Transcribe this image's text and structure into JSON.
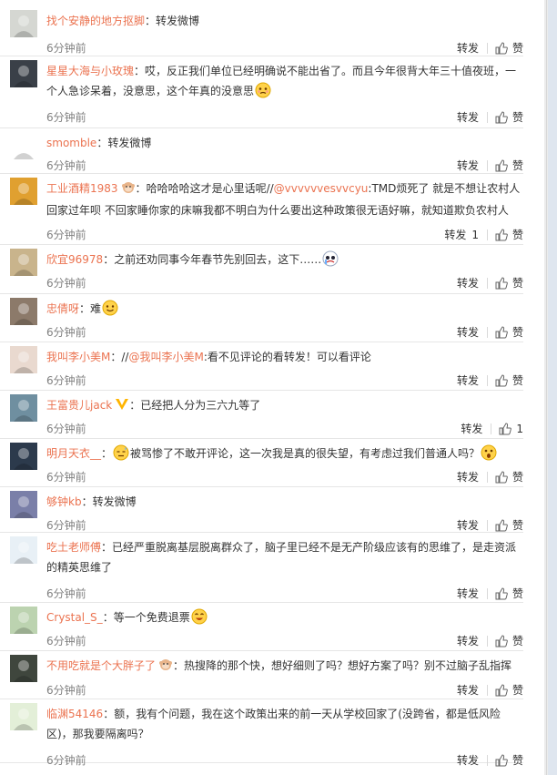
{
  "labels": {
    "repost": "转发",
    "like": "赞"
  },
  "comments": [
    {
      "user": "找个安静的地方抠脚",
      "pre": "：",
      "text": "转发微博",
      "time": "6分钟前",
      "avatar_color": "#d5d7d2"
    },
    {
      "user": "星星大海与小玫瑰",
      "pre": "：",
      "text": "哎，反正我们单位已经明确说不能出省了。而且今年很背大年三十值夜班，一个人急诊呆着，没意思，这个年真的没意思",
      "emoji": "awkward-face",
      "time": "6分钟前",
      "avatar_color": "#3a4048"
    },
    {
      "user": "smomble",
      "pre": "：",
      "text": "转发微博",
      "time": "6分钟前",
      "avatar_color": "#ffffff"
    },
    {
      "user": "工业酒精1983",
      "badge": "monkey-badge",
      "pre": "：",
      "text": "哈哈哈哈这才是心里话呢//",
      "mention": "@vvvvvvesvvcyu",
      "text2": ":TMD烦死了 就是不想让农村人回家过年呗 不回家睡你家的床嘛我都不明白为什么要出这种政策很无语好嘛，就知道欺负农村人",
      "time": "6分钟前",
      "repost_count": "1",
      "avatar_color": "#e0a030"
    },
    {
      "user": "欣宜96978",
      "pre": "：",
      "text": "之前还劝同事今年春节先别回去，这下……",
      "emoji": "crying-face",
      "time": "6分钟前",
      "avatar_color": "#c9b48c"
    },
    {
      "user": "忠倩呀",
      "pre": "：",
      "text": "难",
      "emoji": "smile-face",
      "time": "6分钟前",
      "avatar_color": "#8c7a6a"
    },
    {
      "user": "我叫李小美M",
      "pre": "：//",
      "mention": "@我叫李小美M",
      "text2": ":看不见评论的看转发！可以看评论",
      "time": "6分钟前",
      "avatar_color": "#e9d9cf"
    },
    {
      "user": "王富贵儿jack",
      "badge": "v-badge",
      "pre": "：",
      "text": "已经把人分为三六九等了",
      "time": "6分钟前",
      "like_count": "1",
      "avatar_color": "#6f8fa0"
    },
    {
      "user": "明月天衣__",
      "pre": "：",
      "emoji_pre": "sweat-face",
      "text": "被骂惨了不敢开评论，这一次我是真的很失望，有考虑过我们普通人吗？",
      "emoji": "shock-face",
      "time": "6分钟前",
      "avatar_color": "#2c3a4c"
    },
    {
      "user": "够钟kb",
      "pre": "：",
      "text": "转发微博",
      "time": "6分钟前",
      "avatar_color": "#7a7fa8"
    },
    {
      "user": "吃土老师傅",
      "pre": "：",
      "text": "已经严重脱离基层脱离群众了，脑子里已经不是无产阶级应该有的思维了，是走资派的精英思维了",
      "time": "6分钟前",
      "avatar_color": "#e8f0f6"
    },
    {
      "user": "Crystal_S_",
      "pre": "：",
      "text": "等一个免费退票",
      "emoji": "laugh-face",
      "time": "6分钟前",
      "avatar_color": "#bcd3b0"
    },
    {
      "user": "不用吃就是个大胖子了",
      "badge": "monkey-badge",
      "pre": "：",
      "text": "热搜降的那个快，想好细则了吗？想好方案了吗？别不过脑子乱指挥",
      "time": "6分钟前",
      "avatar_color": "#3f463d"
    },
    {
      "user": "临渊54146",
      "pre": "：",
      "text": "额，我有个问题，我在这个政策出来的前一天从学校回家了(没跨省，都是低风险区)，那我要隔离吗？",
      "time": "6分钟前",
      "avatar_color": "#e3efd8"
    }
  ]
}
